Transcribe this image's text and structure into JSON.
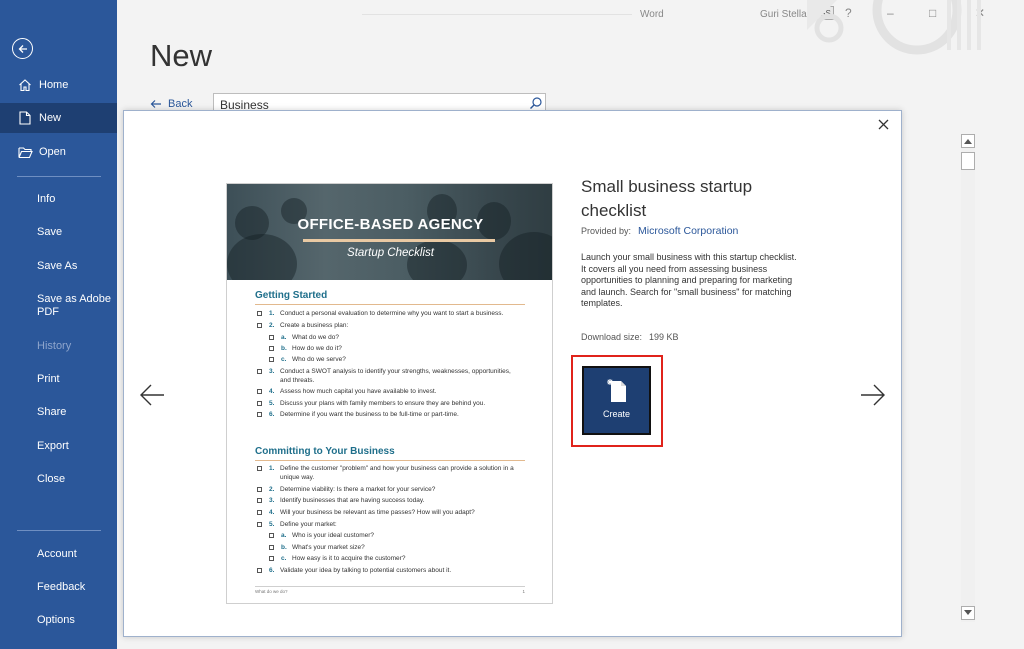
{
  "sidebar": {
    "items": [
      {
        "label": "Home",
        "icon": "home-icon"
      },
      {
        "label": "New",
        "icon": "new-document-icon"
      },
      {
        "label": "Open",
        "icon": "open-folder-icon"
      },
      {
        "label": "Info"
      },
      {
        "label": "Save"
      },
      {
        "label": "Save As"
      },
      {
        "label": "Save as Adobe PDF"
      },
      {
        "label": "History"
      },
      {
        "label": "Print"
      },
      {
        "label": "Share"
      },
      {
        "label": "Export"
      },
      {
        "label": "Close"
      },
      {
        "label": "Account"
      },
      {
        "label": "Feedback"
      },
      {
        "label": "Options"
      }
    ]
  },
  "header": {
    "title": "New",
    "app_name": "Word",
    "user_name": "Guri Stella",
    "user_initials": "GS"
  },
  "search": {
    "back_label": "Back",
    "value": "Business"
  },
  "template": {
    "title": "Small business startup checklist",
    "provided_by_label": "Provided by:",
    "provider": "Microsoft Corporation",
    "description": "Launch your small business with this startup checklist. It covers all you need from assessing business opportunities to planning and preparing for marketing and launch. Search for \"small business\" for matching templates.",
    "download_size_label": "Download size:",
    "download_size": "199 KB",
    "create_label": "Create"
  },
  "preview": {
    "banner_title": "OFFICE-BASED AGENCY",
    "banner_subtitle": "Startup Checklist",
    "sections": [
      {
        "heading": "Getting Started",
        "items": [
          {
            "num": "1.",
            "text": "Conduct a personal evaluation to determine why you want to start a business."
          },
          {
            "num": "2.",
            "text": "Create a business plan:"
          },
          {
            "num": "a.",
            "text": "What do we do?"
          },
          {
            "num": "b.",
            "text": "How do we do it?"
          },
          {
            "num": "c.",
            "text": "Who do we serve?"
          },
          {
            "num": "3.",
            "text": "Conduct a SWOT analysis to identify your strengths, weaknesses, opportunities, and threats."
          },
          {
            "num": "4.",
            "text": "Assess how much capital you have available to invest."
          },
          {
            "num": "5.",
            "text": "Discuss your plans with family members to ensure they are behind you."
          },
          {
            "num": "6.",
            "text": "Determine if you want the business to be full-time or part-time."
          }
        ]
      },
      {
        "heading": "Committing to Your Business",
        "items": [
          {
            "num": "1.",
            "text": "Define the customer \"problem\" and how your business can provide a solution in a unique way."
          },
          {
            "num": "2.",
            "text": "Determine viability: Is there a market for your service?"
          },
          {
            "num": "3.",
            "text": "Identify businesses that are having success today."
          },
          {
            "num": "4.",
            "text": "Will your business be relevant as time passes? How will you adapt?"
          },
          {
            "num": "5.",
            "text": "Define your market:"
          },
          {
            "num": "a.",
            "text": "Who is your ideal customer?"
          },
          {
            "num": "b.",
            "text": "What's your market size?"
          },
          {
            "num": "c.",
            "text": "How easy is it to acquire the customer?"
          },
          {
            "num": "6.",
            "text": "Validate your idea by talking to potential customers about it."
          }
        ]
      }
    ],
    "footer_left": "What do we do?",
    "footer_right": "1"
  },
  "colors": {
    "sidebar": "#2b579a",
    "sidebar_active": "#1e3f72",
    "create_button": "#1e3f72",
    "highlight": "#e0231b",
    "section_heading": "#1f6f8b"
  }
}
